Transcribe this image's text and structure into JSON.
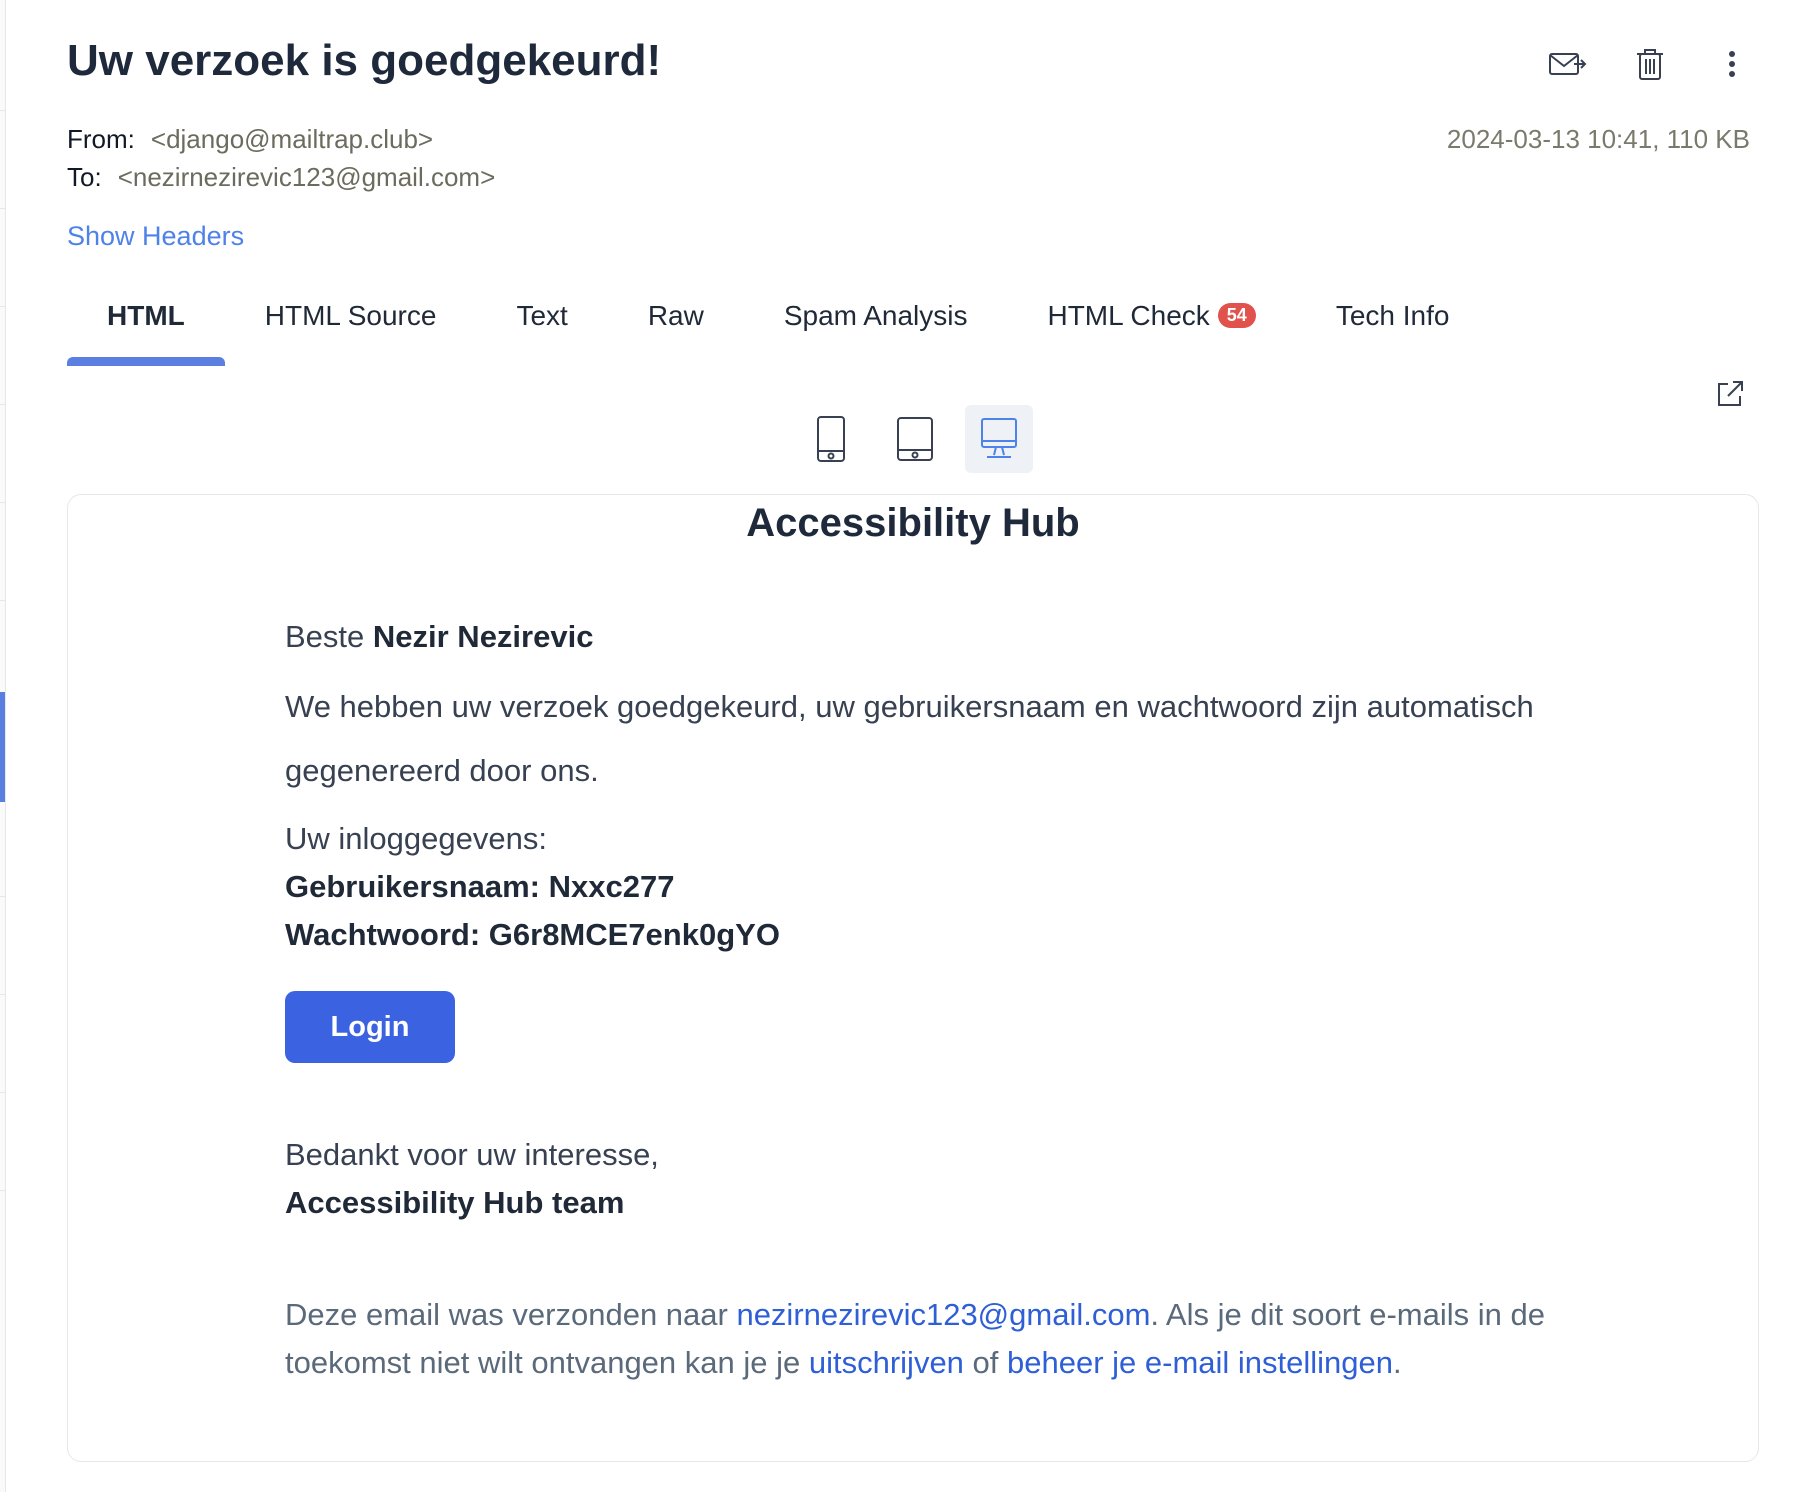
{
  "message": {
    "subject": "Uw verzoek is goedgekeurd!",
    "from_label": "From:",
    "from_value": "<django@mailtrap.club>",
    "to_label": "To:",
    "to_value": "<nezirnezirevic123@gmail.com>",
    "date_size": "2024-03-13 10:41, 110 KB",
    "show_headers": "Show Headers"
  },
  "actions": [
    {
      "icon": "forward-mail-icon"
    },
    {
      "icon": "trash-icon"
    },
    {
      "icon": "more-vertical-icon"
    }
  ],
  "tabs": [
    {
      "label": "HTML",
      "active": true
    },
    {
      "label": "HTML Source"
    },
    {
      "label": "Text"
    },
    {
      "label": "Raw"
    },
    {
      "label": "Spam Analysis"
    },
    {
      "label": "HTML Check",
      "badge": "54"
    },
    {
      "label": "Tech Info"
    }
  ],
  "device_view": {
    "options": [
      "mobile",
      "tablet",
      "desktop"
    ],
    "selected": "desktop"
  },
  "email": {
    "brand": "Accessibility Hub",
    "greeting_prefix": "Beste ",
    "greeting_name": "Nezir Nezirevic",
    "intro": "We hebben uw verzoek goedgekeurd, uw gebruikersnaam en wachtwoord zijn automatisch gegenereerd door ons.",
    "creds_heading": "Uw inloggegevens:",
    "username_line": "Gebruikersnaam: Nxxc277",
    "password_line": "Wachtwoord: G6r8MCE7enk0gYO",
    "login_label": "Login",
    "thanks": "Bedankt voor uw interesse,",
    "team": "Accessibility Hub team",
    "footer_prefix": "Deze email was verzonden naar ",
    "footer_email": "nezirnezirevic123@gmail.com",
    "footer_mid": ". Als je dit soort e-mails in de toekomst niet wilt ontvangen kan je je ",
    "footer_unsubscribe": "uitschrijven",
    "footer_or": " of ",
    "footer_manage": "beheer je e-mail instellingen",
    "footer_end": "."
  },
  "colors": {
    "accent": "#5b7fe0",
    "login_button": "#3b62e0",
    "badge": "#e0524b",
    "link": "#2f5fd6"
  }
}
